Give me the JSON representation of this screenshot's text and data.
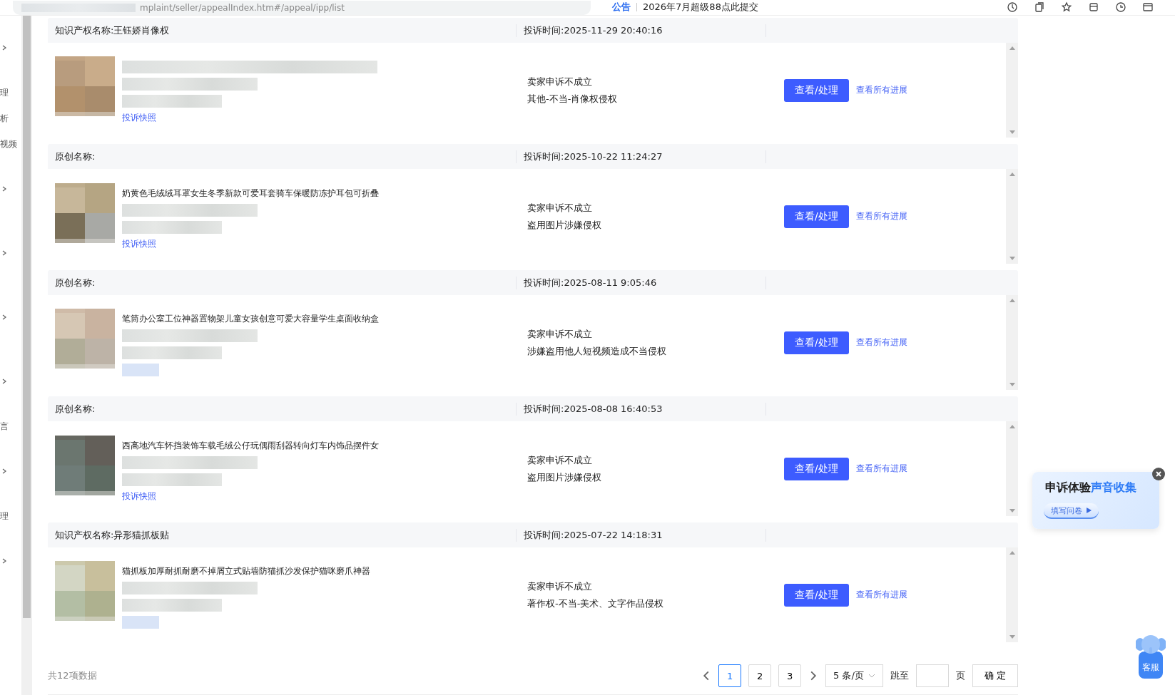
{
  "browser": {
    "url": "mplaint/seller/appealIndex.htm#/appeal/ipp/list",
    "notice_label": "公告",
    "notice_text": "2026年7月超级88点此提交"
  },
  "sidebar": {
    "items": [
      {
        "kind": "chevron"
      },
      {
        "kind": "text",
        "label": "理"
      },
      {
        "kind": "text",
        "label": "析"
      },
      {
        "kind": "text",
        "label": "视频"
      },
      {
        "kind": "chevron"
      },
      {
        "kind": "chevron"
      },
      {
        "kind": "chevron"
      },
      {
        "kind": "chevron"
      },
      {
        "kind": "text",
        "label": "言"
      },
      {
        "kind": "chevron"
      },
      {
        "kind": "text",
        "label": "理"
      },
      {
        "kind": "chevron"
      }
    ]
  },
  "cases": [
    {
      "header": "知识产权名称:王钰娇肖像权",
      "time": "投诉时间:2025-11-29 20:40:16",
      "snapshot_link": "投诉快照",
      "status": "卖家申诉不成立",
      "reason": "其他-不当-肖像权侵权",
      "action": "查看/处理",
      "progress_link": "查看所有进展"
    },
    {
      "header": "原创名称:",
      "time": "投诉时间:2025-10-22 11:24:27",
      "product_title": "奶黄色毛绒绒耳罩女生冬季新款可爱耳套骑车保暖防冻护耳包可折叠",
      "snapshot_link": "投诉快照",
      "status": "卖家申诉不成立",
      "reason": "盗用图片涉嫌侵权",
      "action": "查看/处理",
      "progress_link": "查看所有进展"
    },
    {
      "header": "原创名称:",
      "time": "投诉时间:2025-08-11 9:05:46",
      "product_title": "笔筒办公室工位神器置物架儿童女孩创意可爱大容量学生桌面收纳盒",
      "status": "卖家申诉不成立",
      "reason": "涉嫌盗用他人短视频造成不当侵权",
      "action": "查看/处理",
      "progress_link": "查看所有进展"
    },
    {
      "header": "原创名称:",
      "time": "投诉时间:2025-08-08 16:40:53",
      "product_title": "西高地汽车怀挡装饰车载毛绒公仔玩偶雨刮器转向灯车内饰品摆件女",
      "snapshot_link": "投诉快照",
      "status": "卖家申诉不成立",
      "reason": "盗用图片涉嫌侵权",
      "action": "查看/处理",
      "progress_link": "查看所有进展"
    },
    {
      "header": "知识产权名称:异形猫抓板贴",
      "time": "投诉时间:2025-07-22 14:18:31",
      "product_title": "猫抓板加厚耐抓耐磨不掉屑立式贴墙防猫抓沙发保护猫咪磨爪神器",
      "status": "卖家申诉不成立",
      "reason": "著作权-不当-美术、文字作品侵权",
      "action": "查看/处理",
      "progress_link": "查看所有进展"
    }
  ],
  "footer": {
    "total": "共12项数据",
    "pages": [
      {
        "label": "1",
        "selected": true
      },
      {
        "label": "2",
        "selected": false
      },
      {
        "label": "3",
        "selected": false
      }
    ],
    "page_size": "5 条/页",
    "jump_label": "跳至",
    "page_unit": "页",
    "confirm": "确 定"
  },
  "survey": {
    "title_dark": "申诉体验",
    "title_accent": "声音收集",
    "button": "填写问卷"
  },
  "service": {
    "label": "客服"
  }
}
